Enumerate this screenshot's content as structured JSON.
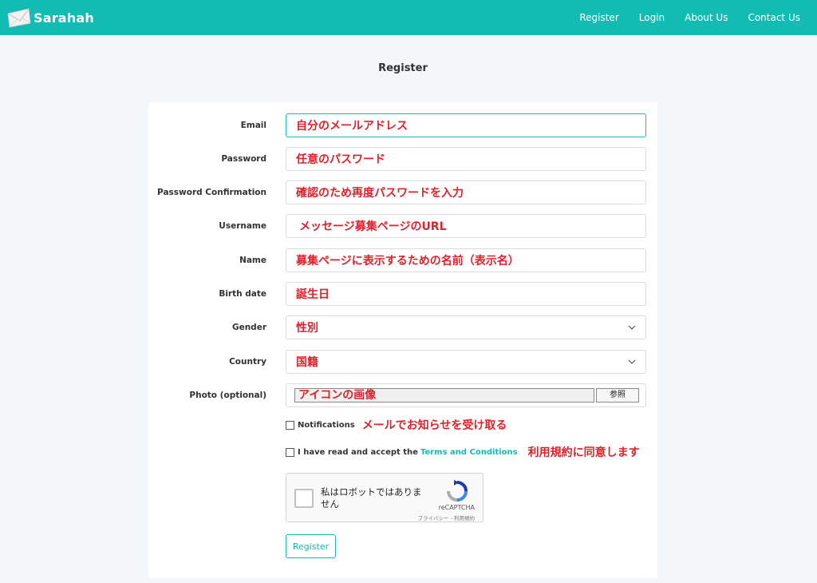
{
  "nav": {
    "brand": "Sarahah",
    "links": [
      "Register",
      "Login",
      "About Us",
      "Contact Us"
    ]
  },
  "page_title": "Register",
  "form": {
    "fields": [
      {
        "label": "Email",
        "value": "自分のメールアドレス"
      },
      {
        "label": "Password",
        "value": "任意のパスワード"
      },
      {
        "label": "Password Confirmation",
        "value": "確認のため再度パスワードを入力"
      },
      {
        "label": "Username",
        "value": "メッセージ募集ページのURL"
      },
      {
        "label": "Name",
        "value": "募集ページに表示するための名前（表示名）"
      },
      {
        "label": "Birth date",
        "value": "誕生日"
      },
      {
        "label": "Gender",
        "value": "性別"
      },
      {
        "label": "Country",
        "value": "国籍"
      }
    ],
    "photo": {
      "label": "Photo (optional)",
      "value": "アイコンの画像",
      "button": "参照"
    },
    "notifications": {
      "label": "Notifications",
      "note": "メールでお知らせを受け取る"
    },
    "terms": {
      "label": "I have read and accept the",
      "link": "Terms and Conditions",
      "note": "利用規約に同意します"
    },
    "recaptcha": {
      "text": "私はロボットではありません",
      "brand": "reCAPTCHA",
      "privacy": "プライバシー - 利用規約"
    },
    "submit": "Register"
  },
  "colors": {
    "accent": "#12bcb2",
    "annotation": "#e0202a"
  }
}
